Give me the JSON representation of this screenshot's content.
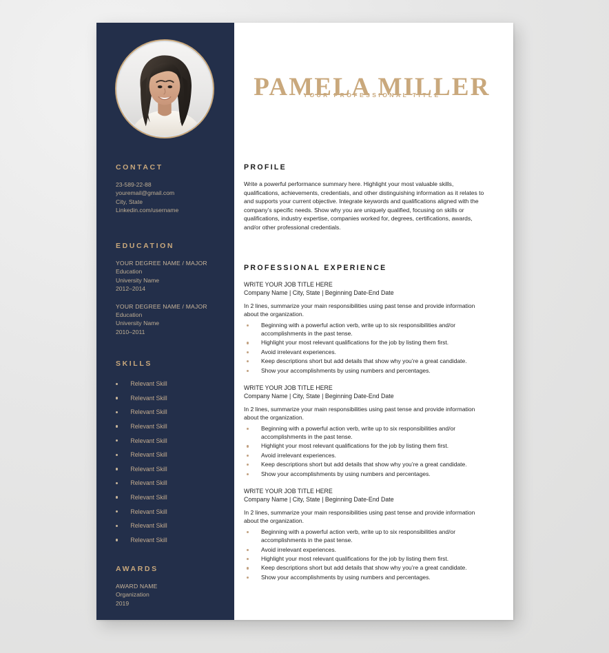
{
  "colors": {
    "navy": "#232f4a",
    "gold": "#c9a87c",
    "sidebar_text": "#bfae93",
    "page_background": "#ffffff",
    "canvas_background": "#e9e9e9"
  },
  "header": {
    "name": "PAMELA MILLER",
    "subtitle": "YOUR PROFESSIONAL TITLE"
  },
  "sidebar": {
    "photo_alt": "profile-photo",
    "contact": {
      "heading": "CONTACT",
      "lines": [
        "23-589-22-88",
        "youremail@gmail.com",
        "City, State",
        "Linkedin.com/username"
      ]
    },
    "education": {
      "heading": "EDUCATION",
      "entries": [
        {
          "degree": "YOUR DEGREE NAME / MAJOR",
          "level": "Education",
          "school": "University Name",
          "dates": "2012–2014"
        },
        {
          "degree": "YOUR DEGREE NAME / MAJOR",
          "level": "Education",
          "school": "University Name",
          "dates": "2010–2011"
        }
      ]
    },
    "skills": {
      "heading": "SKILLS",
      "items": [
        "Relevant Skill",
        "Relevant Skill",
        "Relevant Skill",
        "Relevant Skill",
        "Relevant Skill",
        "Relevant Skill",
        "Relevant Skill",
        "Relevant Skill",
        "Relevant Skill",
        "Relevant Skill",
        "Relevant Skill",
        "Relevant Skill"
      ]
    },
    "awards": {
      "heading": "AWARDS",
      "entries": [
        {
          "name": "AWARD NAME",
          "organization": "Organization",
          "year": "2019"
        }
      ]
    }
  },
  "main": {
    "profile": {
      "heading": "PROFILE",
      "text": "Write a powerful performance summary here. Highlight your most valuable skills, qualifications, achievements, credentials, and other distinguishing information as it relates to and supports your current objective. Integrate keywords and qualifications aligned with the company’s specific needs. Show why you are uniquely qualified, focusing on skills or qualifications, industry expertise, companies worked for, degrees, certifications, awards, and/or other professional credentials."
    },
    "experience": {
      "heading": "PROFESSIONAL EXPERIENCE",
      "jobs": [
        {
          "title": "WRITE YOUR JOB TITLE HERE",
          "meta": "Company Name | City, State | Beginning Date-End Date",
          "summary": "In 2 lines, summarize your main responsibilities using past tense and provide information about the organization.",
          "bullets": [
            "Beginning with a powerful action verb, write up to six responsibilities and/or accomplishments in the past tense.",
            "Highlight your most relevant qualifications for the job by listing them first.",
            "Avoid irrelevant experiences.",
            "Keep descriptions short but add details that show why you’re a great candidate.",
            "Show your accomplishments by using numbers and percentages."
          ]
        },
        {
          "title": "WRITE YOUR JOB TITLE HERE",
          "meta": "Company Name | City, State | Beginning Date-End Date",
          "summary": "In 2 lines, summarize your main responsibilities using past tense and provide information about the organization.",
          "bullets": [
            "Beginning with a powerful action verb, write up to six responsibilities and/or accomplishments in the past tense.",
            "Highlight your most relevant qualifications for the job by listing them first.",
            "Avoid irrelevant experiences.",
            "Keep descriptions short but add details that show why you’re a great candidate.",
            "Show your accomplishments by using numbers and percentages."
          ]
        },
        {
          "title": "WRITE YOUR JOB TITLE HERE",
          "meta": "Company Name | City, State | Beginning Date-End Date",
          "summary": "In 2 lines, summarize your main responsibilities using past tense and provide information about the organization.",
          "bullets": [
            "Beginning with a powerful action verb, write up to six responsibilities and/or accomplishments in the past tense.",
            "Avoid irrelevant experiences.",
            "Highlight your most relevant qualifications for the job by listing them first.",
            "Keep descriptions short but add details that show why you’re a great candidate.",
            "Show your accomplishments by using numbers and percentages."
          ]
        }
      ]
    }
  }
}
